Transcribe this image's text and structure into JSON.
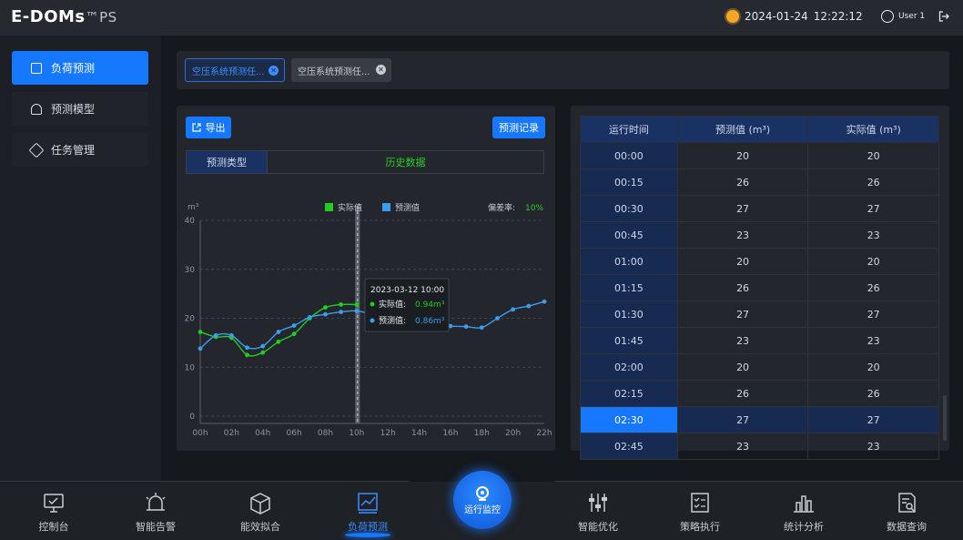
{
  "header": {
    "logo": "E-DOMs",
    "logo_suffix": "™PS",
    "date": "2024-01-24",
    "time": "12:22:12",
    "user": "User 1"
  },
  "sidebar": {
    "items": [
      {
        "label": "负荷预测",
        "active": true
      },
      {
        "label": "预测模型",
        "active": false
      },
      {
        "label": "任务管理",
        "active": false
      }
    ]
  },
  "doc_tabs": [
    {
      "label": "空压系统预测任...",
      "active": true
    },
    {
      "label": "空压系统预测任...",
      "active": false
    }
  ],
  "chart_panel": {
    "export_label": "导出",
    "record_label": "预测记录",
    "subtab_type": "预测类型",
    "subtab_history": "历史数据"
  },
  "chart_data": {
    "type": "line",
    "unit": "m³",
    "x": [
      "00h",
      "01h",
      "02h",
      "03h",
      "04h",
      "05h",
      "06h",
      "07h",
      "08h",
      "09h",
      "10h",
      "11h",
      "12h",
      "13h",
      "14h",
      "15h",
      "16h",
      "17h",
      "18h",
      "19h",
      "20h",
      "21h",
      "22h"
    ],
    "x_tick_labels": [
      "00h",
      "02h",
      "04h",
      "06h",
      "08h",
      "10h",
      "12h",
      "14h",
      "16h",
      "18h",
      "20h",
      "22h"
    ],
    "ylim": [
      0,
      40
    ],
    "yticks": [
      0,
      10,
      20,
      30,
      40
    ],
    "series": [
      {
        "name": "实际值",
        "color": "#22cc22",
        "values": [
          17.2,
          16.2,
          16.0,
          12.5,
          13.0,
          15.2,
          16.8,
          20.0,
          22.2,
          22.8,
          22.8,
          null,
          null,
          null,
          null,
          null,
          null,
          null,
          null,
          null,
          null,
          null,
          null
        ]
      },
      {
        "name": "预测值",
        "color": "#3b9cf0",
        "values": [
          13.8,
          16.5,
          16.5,
          14.0,
          14.3,
          17.2,
          18.5,
          20.2,
          20.8,
          21.3,
          21.5,
          20.8,
          20.0,
          19.2,
          19.0,
          18.8,
          18.4,
          18.3,
          18.1,
          20.0,
          21.8,
          22.5,
          23.4
        ]
      }
    ],
    "deviation_label": "偏差率:",
    "deviation_value": "10%",
    "tooltip": {
      "time": "2023-03-12 10:00",
      "actual_label": "实际值:",
      "actual_value": "0.94m³",
      "pred_label": "预测值:",
      "pred_value": "0.86m³"
    },
    "grid": true,
    "legend_position": "top-center"
  },
  "table": {
    "headers": [
      "运行时间",
      "预测值 (m³)",
      "实际值 (m³)"
    ],
    "rows": [
      [
        "00:00",
        "20",
        "20"
      ],
      [
        "00:15",
        "26",
        "26"
      ],
      [
        "00:30",
        "27",
        "27"
      ],
      [
        "00:45",
        "23",
        "23"
      ],
      [
        "01:00",
        "20",
        "20"
      ],
      [
        "01:15",
        "26",
        "26"
      ],
      [
        "01:30",
        "27",
        "27"
      ],
      [
        "01:45",
        "23",
        "23"
      ],
      [
        "02:00",
        "20",
        "20"
      ],
      [
        "02:15",
        "26",
        "26"
      ],
      [
        "02:30",
        "27",
        "27"
      ],
      [
        "02:45",
        "23",
        "23"
      ]
    ],
    "selected_row": 10
  },
  "bottom_nav": {
    "items": [
      {
        "label": "控制台",
        "icon": "monitor-icon"
      },
      {
        "label": "智能告警",
        "icon": "alarm-icon"
      },
      {
        "label": "能效拟合",
        "icon": "cube-icon"
      },
      {
        "label": "负荷预测",
        "icon": "trend-icon"
      },
      {
        "label": "智能优化",
        "icon": "sliders-icon"
      },
      {
        "label": "策略执行",
        "icon": "checklist-icon"
      },
      {
        "label": "统计分析",
        "icon": "bar-chart-icon"
      },
      {
        "label": "数据查询",
        "icon": "doc-search-icon"
      }
    ],
    "center_label": "运行监控",
    "active_index": 3
  }
}
